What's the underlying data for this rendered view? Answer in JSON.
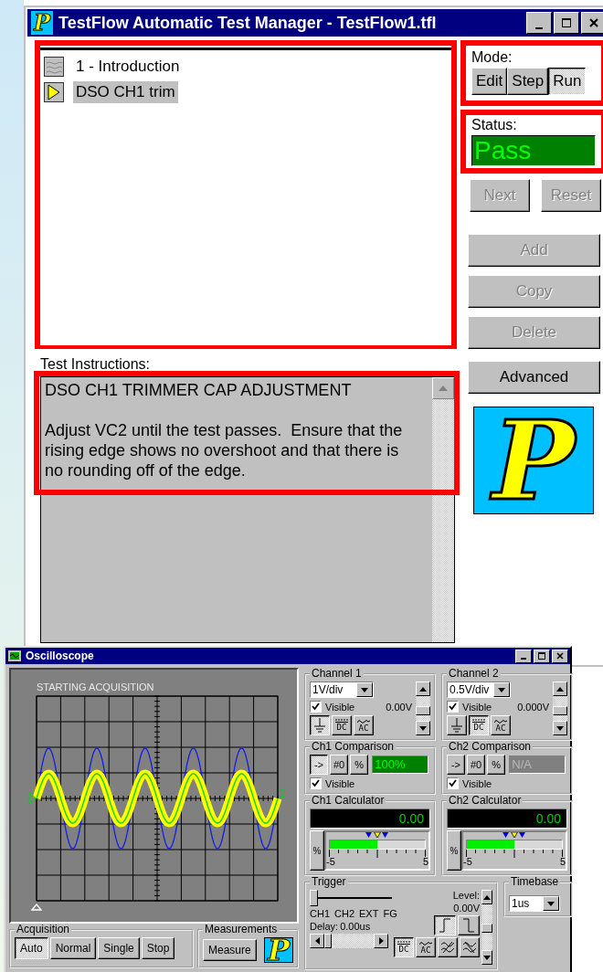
{
  "window": {
    "icon_letter": "P",
    "title": "TestFlow Automatic Test Manager - TestFlow1.tfl"
  },
  "steps": [
    {
      "kind": "page",
      "label": "1 - Introduction",
      "selected": false
    },
    {
      "kind": "test",
      "label": "DSO CH1 trim",
      "selected": true
    }
  ],
  "mode": {
    "label": "Mode:",
    "buttons": [
      {
        "label": "Edit",
        "selected": false
      },
      {
        "label": "Step",
        "selected": false
      },
      {
        "label": "Run",
        "selected": true
      }
    ]
  },
  "status": {
    "label": "Status:",
    "value": "Pass"
  },
  "nav_buttons": [
    {
      "label": "Next",
      "disabled": true
    },
    {
      "label": "Reset",
      "disabled": true
    }
  ],
  "edit_buttons": [
    {
      "label": "Add",
      "disabled": true
    },
    {
      "label": "Copy",
      "disabled": true
    },
    {
      "label": "Delete",
      "disabled": true
    },
    {
      "label": "Advanced",
      "disabled": false
    }
  ],
  "logo_letter": "P",
  "instructions": {
    "label": "Test Instructions:",
    "heading": "DSO CH1 TRIMMER CAP ADJUSTMENT",
    "body": "Adjust VC2 until the test passes.  Ensure that the rising edge shows no overshoot and that there is no rounding off of the edge."
  },
  "oscilloscope": {
    "title": "Oscilloscope",
    "screen_message": "STARTING ACQUISITION",
    "channel_marker": "2",
    "acquisition": {
      "label": "Acquisition",
      "buttons": [
        {
          "label": "Auto",
          "selected": true
        },
        {
          "label": "Normal",
          "selected": false
        },
        {
          "label": "Single",
          "selected": false
        },
        {
          "label": "Stop",
          "selected": false
        }
      ]
    },
    "measurements": {
      "label": "Measurements",
      "button": "Measure",
      "logo_letter": "P"
    },
    "channels": [
      {
        "label": "Channel 1",
        "scale": "1V/div",
        "visible": true,
        "visible_label": "Visible",
        "offset": "0.00V",
        "coupling": [
          {
            "kind": "ground",
            "selected": true
          },
          {
            "kind": "dc",
            "label": "DC",
            "selected": false
          },
          {
            "kind": "ac",
            "label": "AC",
            "selected": false
          }
        ]
      },
      {
        "label": "Channel 2",
        "scale": "0.5V/div",
        "visible": true,
        "visible_label": "Visible",
        "offset": "0.000V",
        "coupling": [
          {
            "kind": "ground",
            "selected": false
          },
          {
            "kind": "dc",
            "label": "DC",
            "selected": true
          },
          {
            "kind": "ac",
            "label": "AC",
            "selected": false
          }
        ]
      }
    ],
    "comparisons": [
      {
        "label": "Ch1 Comparison",
        "buttons": [
          {
            "label": "->",
            "selected": true
          },
          {
            "label": "#0",
            "selected": false
          },
          {
            "label": "%",
            "selected": false
          }
        ],
        "value": "100%",
        "active": true,
        "visible": true,
        "visible_label": "Visible"
      },
      {
        "label": "Ch2 Comparison",
        "buttons": [
          {
            "label": "->",
            "selected": false
          },
          {
            "label": "#0",
            "selected": false
          },
          {
            "label": "%",
            "selected": false
          }
        ],
        "value": "N/A",
        "active": false,
        "visible": true,
        "visible_label": "Visible"
      }
    ],
    "calculators": [
      {
        "label": "Ch1 Calculator",
        "value": "0.00",
        "button": "%",
        "level": 0.5,
        "min": "-5",
        "max": "5"
      },
      {
        "label": "Ch2 Calculator",
        "value": "0.00",
        "button": "%",
        "level": 0.5,
        "min": "-5",
        "max": "5"
      }
    ],
    "trigger": {
      "label": "Trigger",
      "level_label": "Level:",
      "level_value": "0.00V",
      "sources": [
        {
          "label": "CH1",
          "selected": true
        },
        {
          "label": "CH2",
          "selected": false
        },
        {
          "label": "EXT",
          "selected": false
        },
        {
          "label": "FG",
          "selected": false
        }
      ],
      "delay_label": "Delay:",
      "delay": "0.00us",
      "slopes": [
        {
          "kind": "rising",
          "selected": true
        },
        {
          "kind": "falling",
          "selected": false
        }
      ],
      "coupling": [
        {
          "kind": "dc",
          "label": "DC",
          "selected": true
        },
        {
          "kind": "ac",
          "label": "AC",
          "selected": false
        },
        {
          "kind": "hf",
          "selected": false
        },
        {
          "kind": "lf",
          "selected": false
        }
      ]
    },
    "timebase": {
      "label": "Timebase",
      "value": "1us"
    }
  }
}
